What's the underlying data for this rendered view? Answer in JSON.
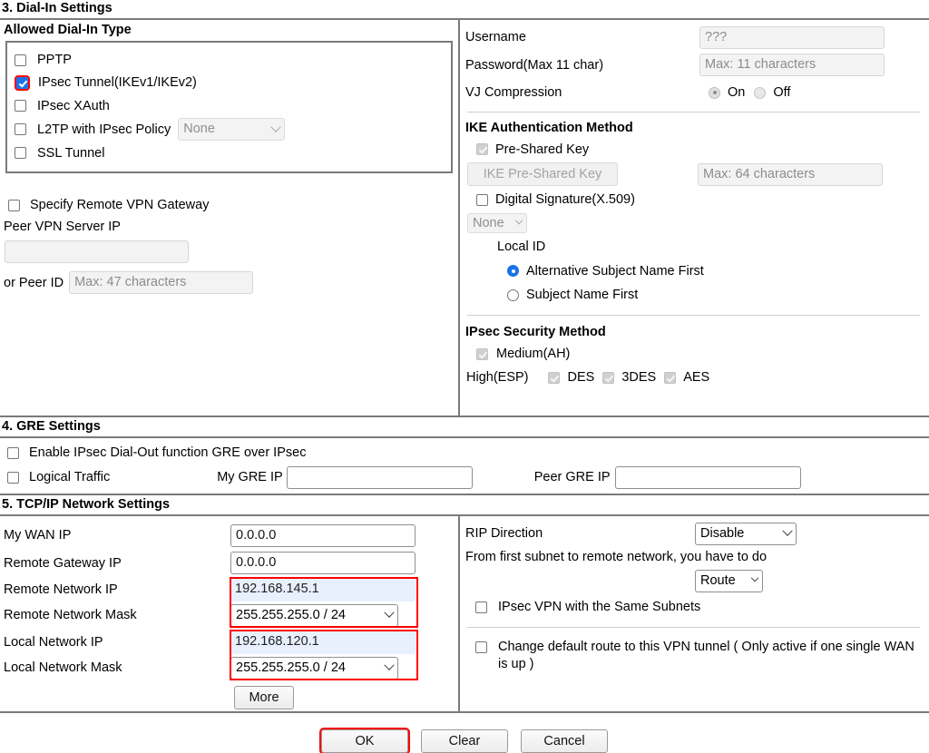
{
  "sections": {
    "dial_in": {
      "number_title": "3. Dial-In Settings",
      "allowed_title": "Allowed Dial-In Type",
      "options": [
        {
          "label": "PPTP",
          "checked": false
        },
        {
          "label": "IPsec Tunnel(IKEv1/IKEv2)",
          "checked": true,
          "highlight": true
        },
        {
          "label": "IPsec XAuth",
          "checked": false
        },
        {
          "label": "L2TP with IPsec Policy",
          "checked": false,
          "select_value": "None"
        },
        {
          "label": "SSL Tunnel",
          "checked": false
        }
      ],
      "specify_remote_gateway": "Specify Remote VPN Gateway",
      "peer_vpn_server_ip_label": "Peer VPN Server IP",
      "peer_vpn_server_ip_value": "",
      "or_peer_id_label": "or Peer ID",
      "or_peer_id_placeholder": "Max: 47 characters"
    },
    "credentials": {
      "username_label": "Username",
      "username_value": "???",
      "password_label": "Password(Max 11 char)",
      "password_placeholder": "Max: 11 characters",
      "vj_label": "VJ Compression",
      "vj_on": "On",
      "vj_off": "Off",
      "vj_selected": "On"
    },
    "ike_auth": {
      "title": "IKE Authentication Method",
      "preshared_key_label": "Pre-Shared Key",
      "preshared_key_checked": true,
      "psk_button_label": "IKE Pre-Shared Key",
      "psk_placeholder": "Max: 64 characters",
      "digital_signature_label": "Digital Signature(X.509)",
      "digital_signature_checked": false,
      "cert_select_value": "None",
      "local_id_label": "Local ID",
      "local_id_options": [
        {
          "label": "Alternative Subject Name First",
          "selected": true
        },
        {
          "label": "Subject Name First",
          "selected": false
        }
      ]
    },
    "ipsec_security": {
      "title": "IPsec Security Method",
      "medium_label": "Medium(AH)",
      "medium_checked": true,
      "high_label": "High(ESP)",
      "high_options": [
        {
          "label": "DES",
          "checked": true
        },
        {
          "label": "3DES",
          "checked": true
        },
        {
          "label": "AES",
          "checked": true
        }
      ]
    },
    "gre": {
      "number_title": "4. GRE Settings",
      "enable_label": "Enable IPsec Dial-Out function GRE over IPsec",
      "enable_checked": false,
      "logical_traffic_label": "Logical Traffic",
      "logical_traffic_checked": false,
      "my_gre_ip_label": "My GRE IP",
      "my_gre_ip_value": "",
      "peer_gre_ip_label": "Peer GRE IP",
      "peer_gre_ip_value": ""
    },
    "tcpip": {
      "number_title": "5. TCP/IP Network Settings",
      "rows": [
        {
          "label": "My WAN IP",
          "value": "0.0.0.0",
          "type": "text"
        },
        {
          "label": "Remote Gateway IP",
          "value": "0.0.0.0",
          "type": "text"
        },
        {
          "label": "Remote Network IP",
          "value": "192.168.145.1",
          "type": "text",
          "autofill": true
        },
        {
          "label": "Remote Network Mask",
          "value": "255.255.255.0 / 24",
          "type": "select"
        },
        {
          "label": "Local Network IP",
          "value": "192.168.120.1",
          "type": "text",
          "autofill": true
        },
        {
          "label": "Local Network Mask",
          "value": "255.255.255.0 / 24",
          "type": "select"
        }
      ],
      "more_button": "More",
      "rip_direction_label": "RIP Direction",
      "rip_direction_value": "Disable",
      "subnet_text": "From first subnet to remote network, you have to do",
      "route_value": "Route",
      "same_subnets_label": "IPsec VPN with the Same Subnets",
      "same_subnets_checked": false,
      "change_default_route_label": "Change default route to this VPN tunnel ( Only active if one single WAN is up )",
      "change_default_route_checked": false
    }
  },
  "footer": {
    "ok_label": "OK",
    "clear_label": "Clear",
    "cancel_label": "Cancel"
  },
  "colors": {
    "highlight": "#ff0000",
    "checkbox_accent": "#1a73e8",
    "autofill_bg": "#e8f0fe"
  }
}
